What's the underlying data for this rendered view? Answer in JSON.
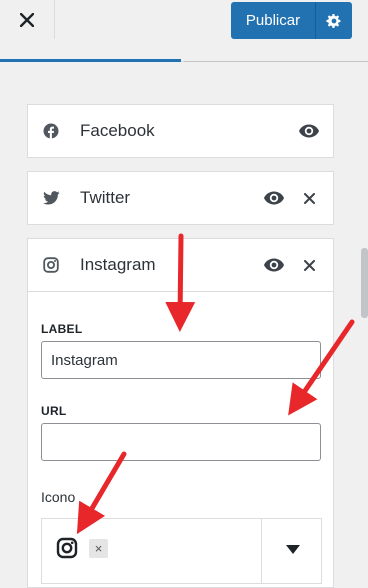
{
  "header": {
    "close_icon": "close-icon",
    "publish_label": "Publicar",
    "settings_icon": "gear-icon"
  },
  "social_items": [
    {
      "title": "Facebook",
      "icon": "facebook-icon",
      "visible_icon": "eye-icon"
    },
    {
      "title": "Twitter",
      "icon": "twitter-icon",
      "visible_icon": "eye-icon",
      "remove_icon": "close-icon"
    },
    {
      "title": "Instagram",
      "icon": "instagram-icon",
      "visible_icon": "eye-icon",
      "remove_icon": "close-icon",
      "expanded": true
    }
  ],
  "instagram_form": {
    "label_caption": "LABEL",
    "label_value": "Instagram",
    "url_caption": "URL",
    "url_value": "",
    "icon_caption": "Icono",
    "icon_selected": "instagram-icon",
    "icon_remove": "×"
  },
  "colors": {
    "accent": "#2271b1",
    "annotation_arrow": "#e8272b"
  }
}
